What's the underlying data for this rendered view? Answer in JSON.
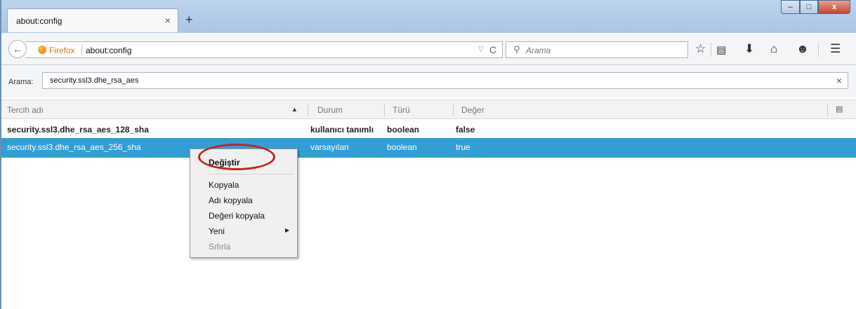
{
  "tab": {
    "title": "about:config",
    "close": "×",
    "new": "+"
  },
  "window_controls": {
    "minimize": "–",
    "maximize": "□",
    "close": "x"
  },
  "urlbar": {
    "identity": "Firefox",
    "url": "about:config",
    "dropdown": "▽",
    "reload": "C"
  },
  "search": {
    "placeholder": "Arama"
  },
  "toolbar_icons": [
    "bookmark-star-icon",
    "reading-list-icon",
    "download-icon",
    "home-icon",
    "pocket-icon",
    "menu-icon"
  ],
  "filter": {
    "label": "Arama:",
    "value": "security.ssl3.dhe_rsa_aes",
    "clear": "×"
  },
  "columns": {
    "name": "Tercih adı",
    "status": "Durum",
    "type": "Türü",
    "value": "Değer"
  },
  "rows": [
    {
      "name": "security.ssl3.dhe_rsa_aes_128_sha",
      "status": "kullanıcı tanımlı",
      "type": "boolean",
      "value": "false"
    },
    {
      "name": "security.ssl3.dhe_rsa_aes_256_sha",
      "status": "varsayılan",
      "type": "boolean",
      "value": "true"
    }
  ],
  "context_menu": {
    "toggle": "Değiştir",
    "copy": "Kopyala",
    "copy_name": "Adı kopyala",
    "copy_value": "Değeri kopyala",
    "new": "Yeni",
    "reset": "Sıfırla"
  },
  "colors": {
    "selection": "#339ed4",
    "highlight_oval": "#cc1f1f",
    "firefox_label": "#d9701e"
  }
}
